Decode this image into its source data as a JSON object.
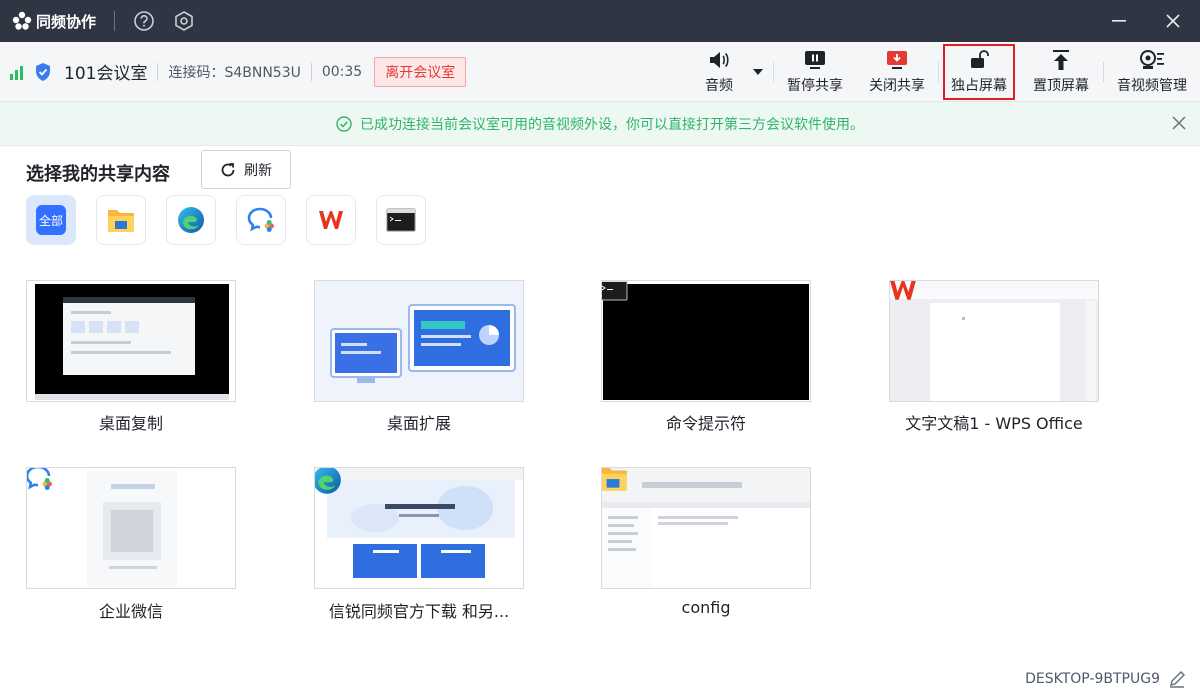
{
  "titlebar": {
    "app_title": "同频协作",
    "icons": [
      "app-logo-icon",
      "help-icon",
      "settings-icon",
      "minimize-icon",
      "close-icon"
    ]
  },
  "toolbar": {
    "room_name": "101会议室",
    "connection_code": "连接码：S4BNN53U",
    "timer": "00:35",
    "leave_label": "离开会议室",
    "tools": [
      {
        "label": "音频",
        "icon": "speaker-icon"
      },
      {
        "label": "暂停共享",
        "icon": "pause-share-icon"
      },
      {
        "label": "关闭共享",
        "icon": "stop-share-icon"
      },
      {
        "label": "独占屏幕",
        "icon": "unlock-icon",
        "highlighted": true
      },
      {
        "label": "置顶屏幕",
        "icon": "pin-top-icon"
      },
      {
        "label": "音视频管理",
        "icon": "av-manage-icon"
      }
    ]
  },
  "notice": {
    "text": "已成功连接当前会议室可用的音视频外设，你可以直接打开第三方会议软件使用。"
  },
  "share": {
    "title": "选择我的共享内容",
    "refresh_label": "刷新",
    "filters": [
      {
        "label": "全部",
        "icon": "all-icon",
        "active": true
      },
      {
        "icon": "file-explorer-icon"
      },
      {
        "icon": "edge-icon"
      },
      {
        "icon": "wecom-icon"
      },
      {
        "icon": "wps-icon"
      },
      {
        "icon": "cmd-icon"
      }
    ],
    "items": [
      {
        "label": "桌面复制",
        "thumb": "desktop-mirror"
      },
      {
        "label": "桌面扩展",
        "thumb": "desktop-extend"
      },
      {
        "label": "命令提示符",
        "thumb": "cmd"
      },
      {
        "label": "文字文稿1 - WPS Office",
        "thumb": "wps"
      },
      {
        "label": "企业微信",
        "thumb": "wecom"
      },
      {
        "label": "信锐同频官方下载 和另...",
        "thumb": "edge"
      },
      {
        "label": "config",
        "thumb": "explorer"
      }
    ]
  },
  "footer": {
    "device_name": "DESKTOP-9BTPUG9"
  },
  "colors": {
    "titlebar_bg": "#2f3542",
    "accent": "#3370ff",
    "leave_red": "#e53935",
    "notice_green": "#31b46e"
  }
}
